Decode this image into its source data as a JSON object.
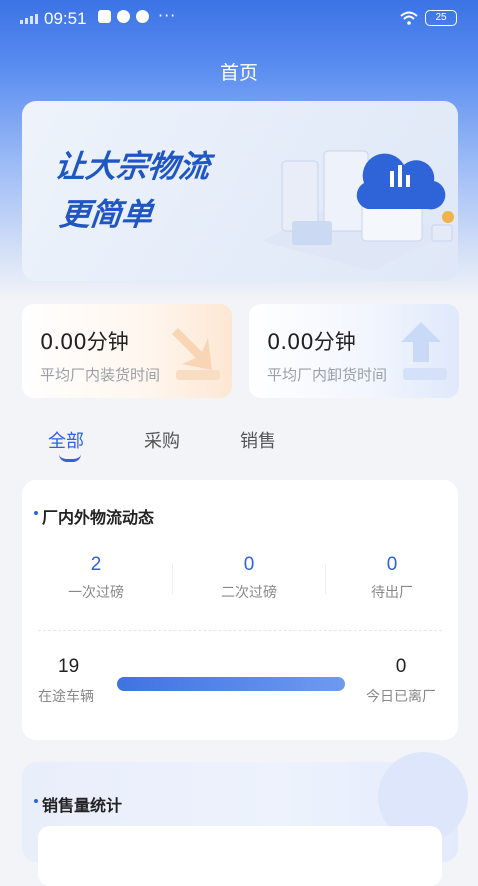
{
  "status_bar": {
    "time": "09:51",
    "battery": "25"
  },
  "header": {
    "title": "首页"
  },
  "banner": {
    "line1": "让大宗物流",
    "line2": "更简单"
  },
  "stats": [
    {
      "value": "0.00分钟",
      "label": "平均厂内装货时间"
    },
    {
      "value": "0.00分钟",
      "label": "平均厂内卸货时间"
    }
  ],
  "tabs": [
    {
      "label": "全部"
    },
    {
      "label": "采购"
    },
    {
      "label": "销售"
    }
  ],
  "active_tab": "全部",
  "logistics": {
    "title": "厂内外物流动态",
    "kpis": [
      {
        "value": "2",
        "label": "一次过磅"
      },
      {
        "value": "0",
        "label": "二次过磅"
      },
      {
        "value": "0",
        "label": "待出厂"
      }
    ],
    "in_transit": {
      "value": "19",
      "label": "在途车辆"
    },
    "left_today": {
      "value": "0",
      "label": "今日已离厂"
    }
  },
  "sales": {
    "title": "销售量统计"
  },
  "colors": {
    "primary": "#2f63d8",
    "header_bg": "#3b73e6",
    "page_bg": "#f2f4f7"
  }
}
